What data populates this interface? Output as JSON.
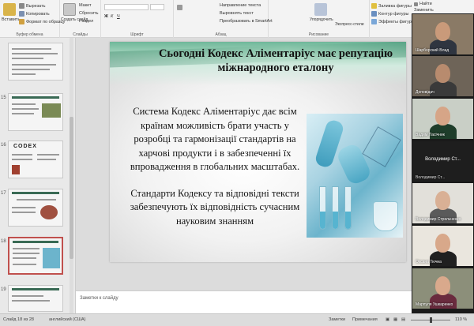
{
  "ribbon": {
    "clipboard": {
      "paste": "Вставить",
      "cut": "Вырезать",
      "copy": "Копировать",
      "format": "Формат по образцу",
      "group": "Буфер обмена"
    },
    "slides": {
      "new_slide": "Создать слайд",
      "layout": "Макет",
      "reset": "Сбросить",
      "section": "Раздел",
      "group": "Слайды"
    },
    "font": {
      "group": "Шрифт"
    },
    "paragraph": {
      "text_direction": "Направление текста",
      "align_text": "Выровнять текст",
      "smartart": "Преобразовать в SmartArt",
      "group": "Абзац"
    },
    "drawing": {
      "arrange": "Упорядочить",
      "quick_styles": "Экспресс-стили",
      "fill": "Заливка фигуры",
      "outline": "Контур фигуры",
      "effects": "Эффекты фигуры",
      "group": "Рисование"
    },
    "editing": {
      "find": "Найти",
      "replace": "Заменить",
      "select": "Выделить",
      "group": "Редакти"
    }
  },
  "thumbnails": [
    {
      "number": "",
      "label": ""
    },
    {
      "number": "15",
      "label": ""
    },
    {
      "number": "16",
      "label": "CODEX"
    },
    {
      "number": "17",
      "label": ""
    },
    {
      "number": "18",
      "label": ""
    },
    {
      "number": "19",
      "label": ""
    }
  ],
  "slide": {
    "title": "Сьогодні Кодекс Аліментаріус має репутацію міжнародного еталону",
    "paragraph1": "Система Кодекс Аліментаріус дає всім країнам можливість брати участь у розробці та гармонізації стандартів на харчові продукти і в забезпеченні їх впровадження в глобальних масштабах.",
    "paragraph2": "Стандарти Кодексу та відповідні тексти забезпечують їх відповідність сучасним науковим знанням"
  },
  "notes": {
    "placeholder": "Заметки к слайду"
  },
  "status": {
    "slide_counter": "Слайд 18 из 28",
    "language": "английский (США)",
    "notes": "Заметки",
    "comments": "Примечания",
    "zoom": "110 %"
  },
  "participants": [
    {
      "name": "Шарборский Влад",
      "colors": {
        "bg": "#8a7a66",
        "skin": "#c99a7a",
        "shirt": "#2f3540"
      }
    },
    {
      "name": "Доповідач",
      "colors": {
        "bg": "#6e6458",
        "skin": "#b88b6e",
        "shirt": "#3a3a3a"
      }
    },
    {
      "name": "Вадим Пасічник",
      "colors": {
        "bg": "#c9cfc6",
        "skin": "#d6a587",
        "shirt": "#1e3d2a"
      }
    },
    {
      "name": "Володимир Ст...",
      "big_name": "Володимир Ст...",
      "colors": {
        "bg": "#1e1e1e"
      }
    },
    {
      "name": "Володимир Стрельченко",
      "colors": {
        "bg": "#e2e0da",
        "skin": "#d9b095",
        "shirt": "#5a5a5a"
      }
    },
    {
      "name": "Оксана Тючна",
      "colors": {
        "bg": "#eae6de",
        "skin": "#d8a88a",
        "shirt": "#202020"
      }
    },
    {
      "name": "Марпуля Ушкаренко",
      "colors": {
        "bg": "#8c8f7a",
        "skin": "#d9a98c",
        "shirt": "#6a2b3e"
      }
    }
  ],
  "video_panel": {
    "find": "Найти",
    "replace": "Заменить"
  },
  "colors": {
    "accent": "#c0504d",
    "slide_stripe": "#6fb89a"
  }
}
